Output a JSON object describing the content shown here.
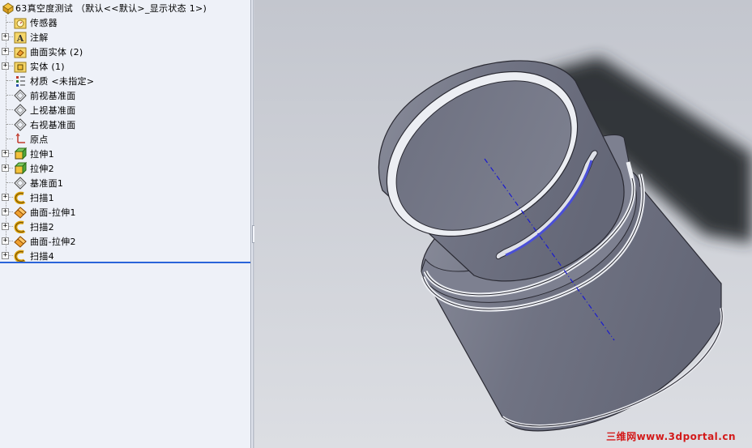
{
  "feature_tree": {
    "root": {
      "label": "63真空度测试 （默认<<默认>_显示状态 1>)",
      "icon": "part-icon"
    },
    "items": [
      {
        "label": "传感器",
        "icon": "sensor-folder-icon",
        "expandable": false
      },
      {
        "label": "注解",
        "icon": "annotation-icon",
        "expandable": true
      },
      {
        "label": "曲面实体 (2)",
        "icon": "surface-bodies-folder-icon",
        "expandable": true
      },
      {
        "label": "实体 (1)",
        "icon": "solid-bodies-folder-icon",
        "expandable": true
      },
      {
        "label": "材质 <未指定>",
        "icon": "material-icon",
        "expandable": false
      },
      {
        "label": "前视基准面",
        "icon": "plane-icon",
        "expandable": false
      },
      {
        "label": "上视基准面",
        "icon": "plane-icon",
        "expandable": false
      },
      {
        "label": "右视基准面",
        "icon": "plane-icon",
        "expandable": false
      },
      {
        "label": "原点",
        "icon": "origin-icon",
        "expandable": false
      },
      {
        "label": "拉伸1",
        "icon": "extrude-icon",
        "expandable": true
      },
      {
        "label": "拉伸2",
        "icon": "extrude-icon",
        "expandable": true
      },
      {
        "label": "基准面1",
        "icon": "plane-icon",
        "expandable": false
      },
      {
        "label": "扫描1",
        "icon": "sweep-icon",
        "expandable": true
      },
      {
        "label": "曲面-拉伸1",
        "icon": "surface-extrude-icon",
        "expandable": true
      },
      {
        "label": "扫描2",
        "icon": "sweep-icon",
        "expandable": true
      },
      {
        "label": "曲面-拉伸2",
        "icon": "surface-extrude-icon",
        "expandable": true
      },
      {
        "label": "扫描4",
        "icon": "sweep-icon",
        "expandable": true
      }
    ]
  },
  "splitter": {
    "icon": "collapse-arrows-icon"
  },
  "viewport": {
    "model": "cylinder-part-with-slot"
  },
  "watermark": {
    "cn": "三维网",
    "url": "www.3dportal.cn"
  },
  "colors": {
    "tree_background": "#eef1f8",
    "rollback_bar": "#2a64d9",
    "viewport_top": "#c6c9d1",
    "part_body": "#7a7d8c",
    "axis_line": "#1a1ad0",
    "watermark": "#d31a1a"
  }
}
